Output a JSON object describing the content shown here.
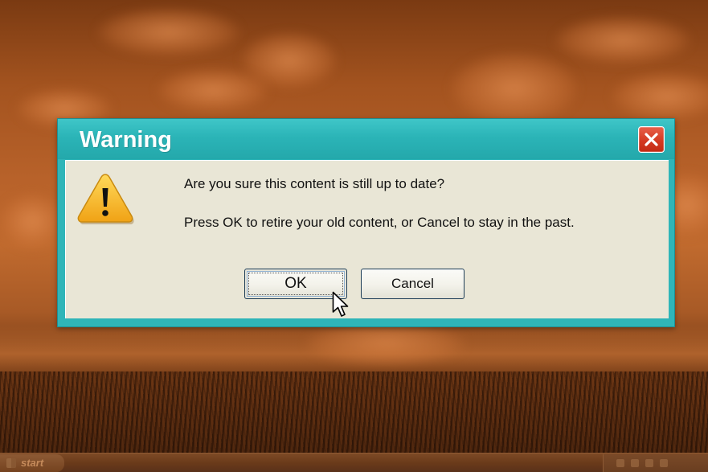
{
  "dialog": {
    "title": "Warning",
    "message_line_1": "Are you sure this content is still up to date?",
    "message_line_2": "Press OK to retire your old content, or Cancel to stay in the past.",
    "ok_label": "OK",
    "cancel_label": "Cancel",
    "icon": "warning-icon",
    "close_icon": "close-icon",
    "colors": {
      "titlebar": "#2fb5b8",
      "client": "#e9e6d6",
      "close_button": "#d43a22",
      "warning_icon": "#f4b51c"
    }
  },
  "taskbar": {
    "start_label": "start"
  }
}
